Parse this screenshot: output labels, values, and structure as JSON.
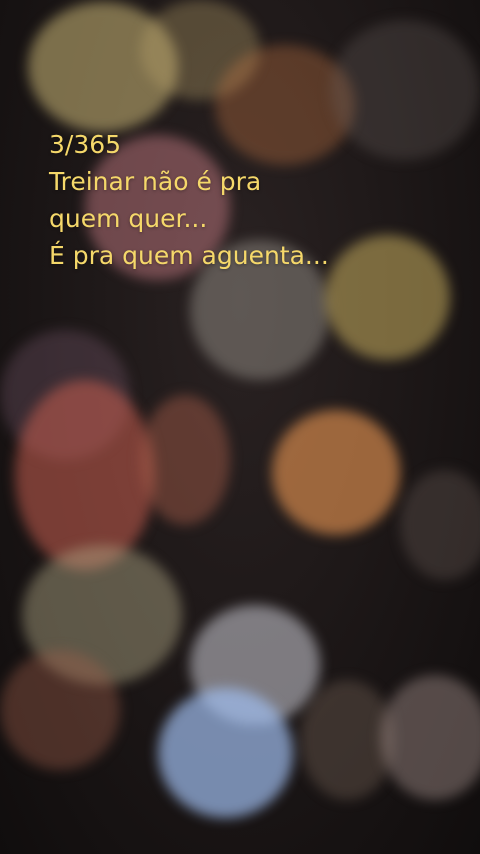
{
  "overlay": {
    "counter": "3/365",
    "line1": "Treinar não é pra",
    "line2": "quem quer...",
    "line3": "É pra quem aguenta..."
  },
  "colors": {
    "text": "#f5d86a",
    "background": "#141010"
  }
}
